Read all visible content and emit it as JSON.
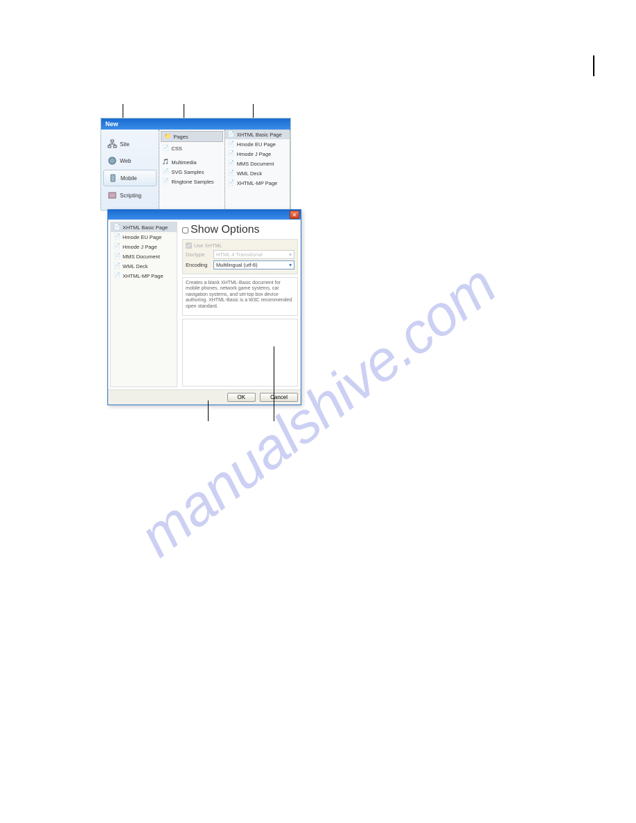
{
  "page_edge_marker": "|",
  "watermark": "manualshive.com",
  "dialog_back": {
    "title": "New",
    "nav": [
      {
        "icon": "site",
        "label": "Site"
      },
      {
        "icon": "web",
        "label": "Web"
      },
      {
        "icon": "mobile",
        "label": "Mobile",
        "selected": true
      },
      {
        "icon": "scripting",
        "label": "Scripting"
      }
    ],
    "categories": [
      {
        "icon": "folder",
        "label": "Pages",
        "header": true
      },
      {
        "icon": "css",
        "label": "CSS"
      },
      {
        "icon": "mm",
        "label": "Multimedia"
      },
      {
        "icon": "svg",
        "label": "SVG Samples"
      },
      {
        "icon": "ring",
        "label": "Ringtone Samples"
      }
    ],
    "types": [
      {
        "icon": "page",
        "label": "XHTML Basic Page",
        "selected": true
      },
      {
        "icon": "page",
        "label": "Hmode EU Page"
      },
      {
        "icon": "page",
        "label": "Hmode J Page"
      },
      {
        "icon": "doc",
        "label": "MMS Document"
      },
      {
        "icon": "wml",
        "label": "WML Deck"
      },
      {
        "icon": "page",
        "label": "XHTML-MP Page"
      }
    ]
  },
  "dialog_front": {
    "types": [
      {
        "icon": "page",
        "label": "XHTML Basic Page",
        "selected": true
      },
      {
        "icon": "page",
        "label": "Hmode EU Page"
      },
      {
        "icon": "page",
        "label": "Hmode J Page"
      },
      {
        "icon": "doc",
        "label": "MMS Document"
      },
      {
        "icon": "wml",
        "label": "WML Deck"
      },
      {
        "icon": "page",
        "label": "XHTML-MP Page"
      }
    ],
    "options": {
      "show_options_label": "Show Options",
      "use_xhtml_label": "Use XHTML",
      "doctype_label": "Doctype",
      "doctype_value": "HTML 4 Transitional",
      "encoding_label": "Encoding",
      "encoding_value": "Multilingual (utf-8)"
    },
    "description": "Creates a blank XHTML-Basic document for mobile phones, network game systems, car navigation systems, and set-top box device authoring. XHTML-Basic is a W3C recommended open standard.",
    "buttons": {
      "ok": "OK",
      "cancel": "Cancel"
    }
  }
}
